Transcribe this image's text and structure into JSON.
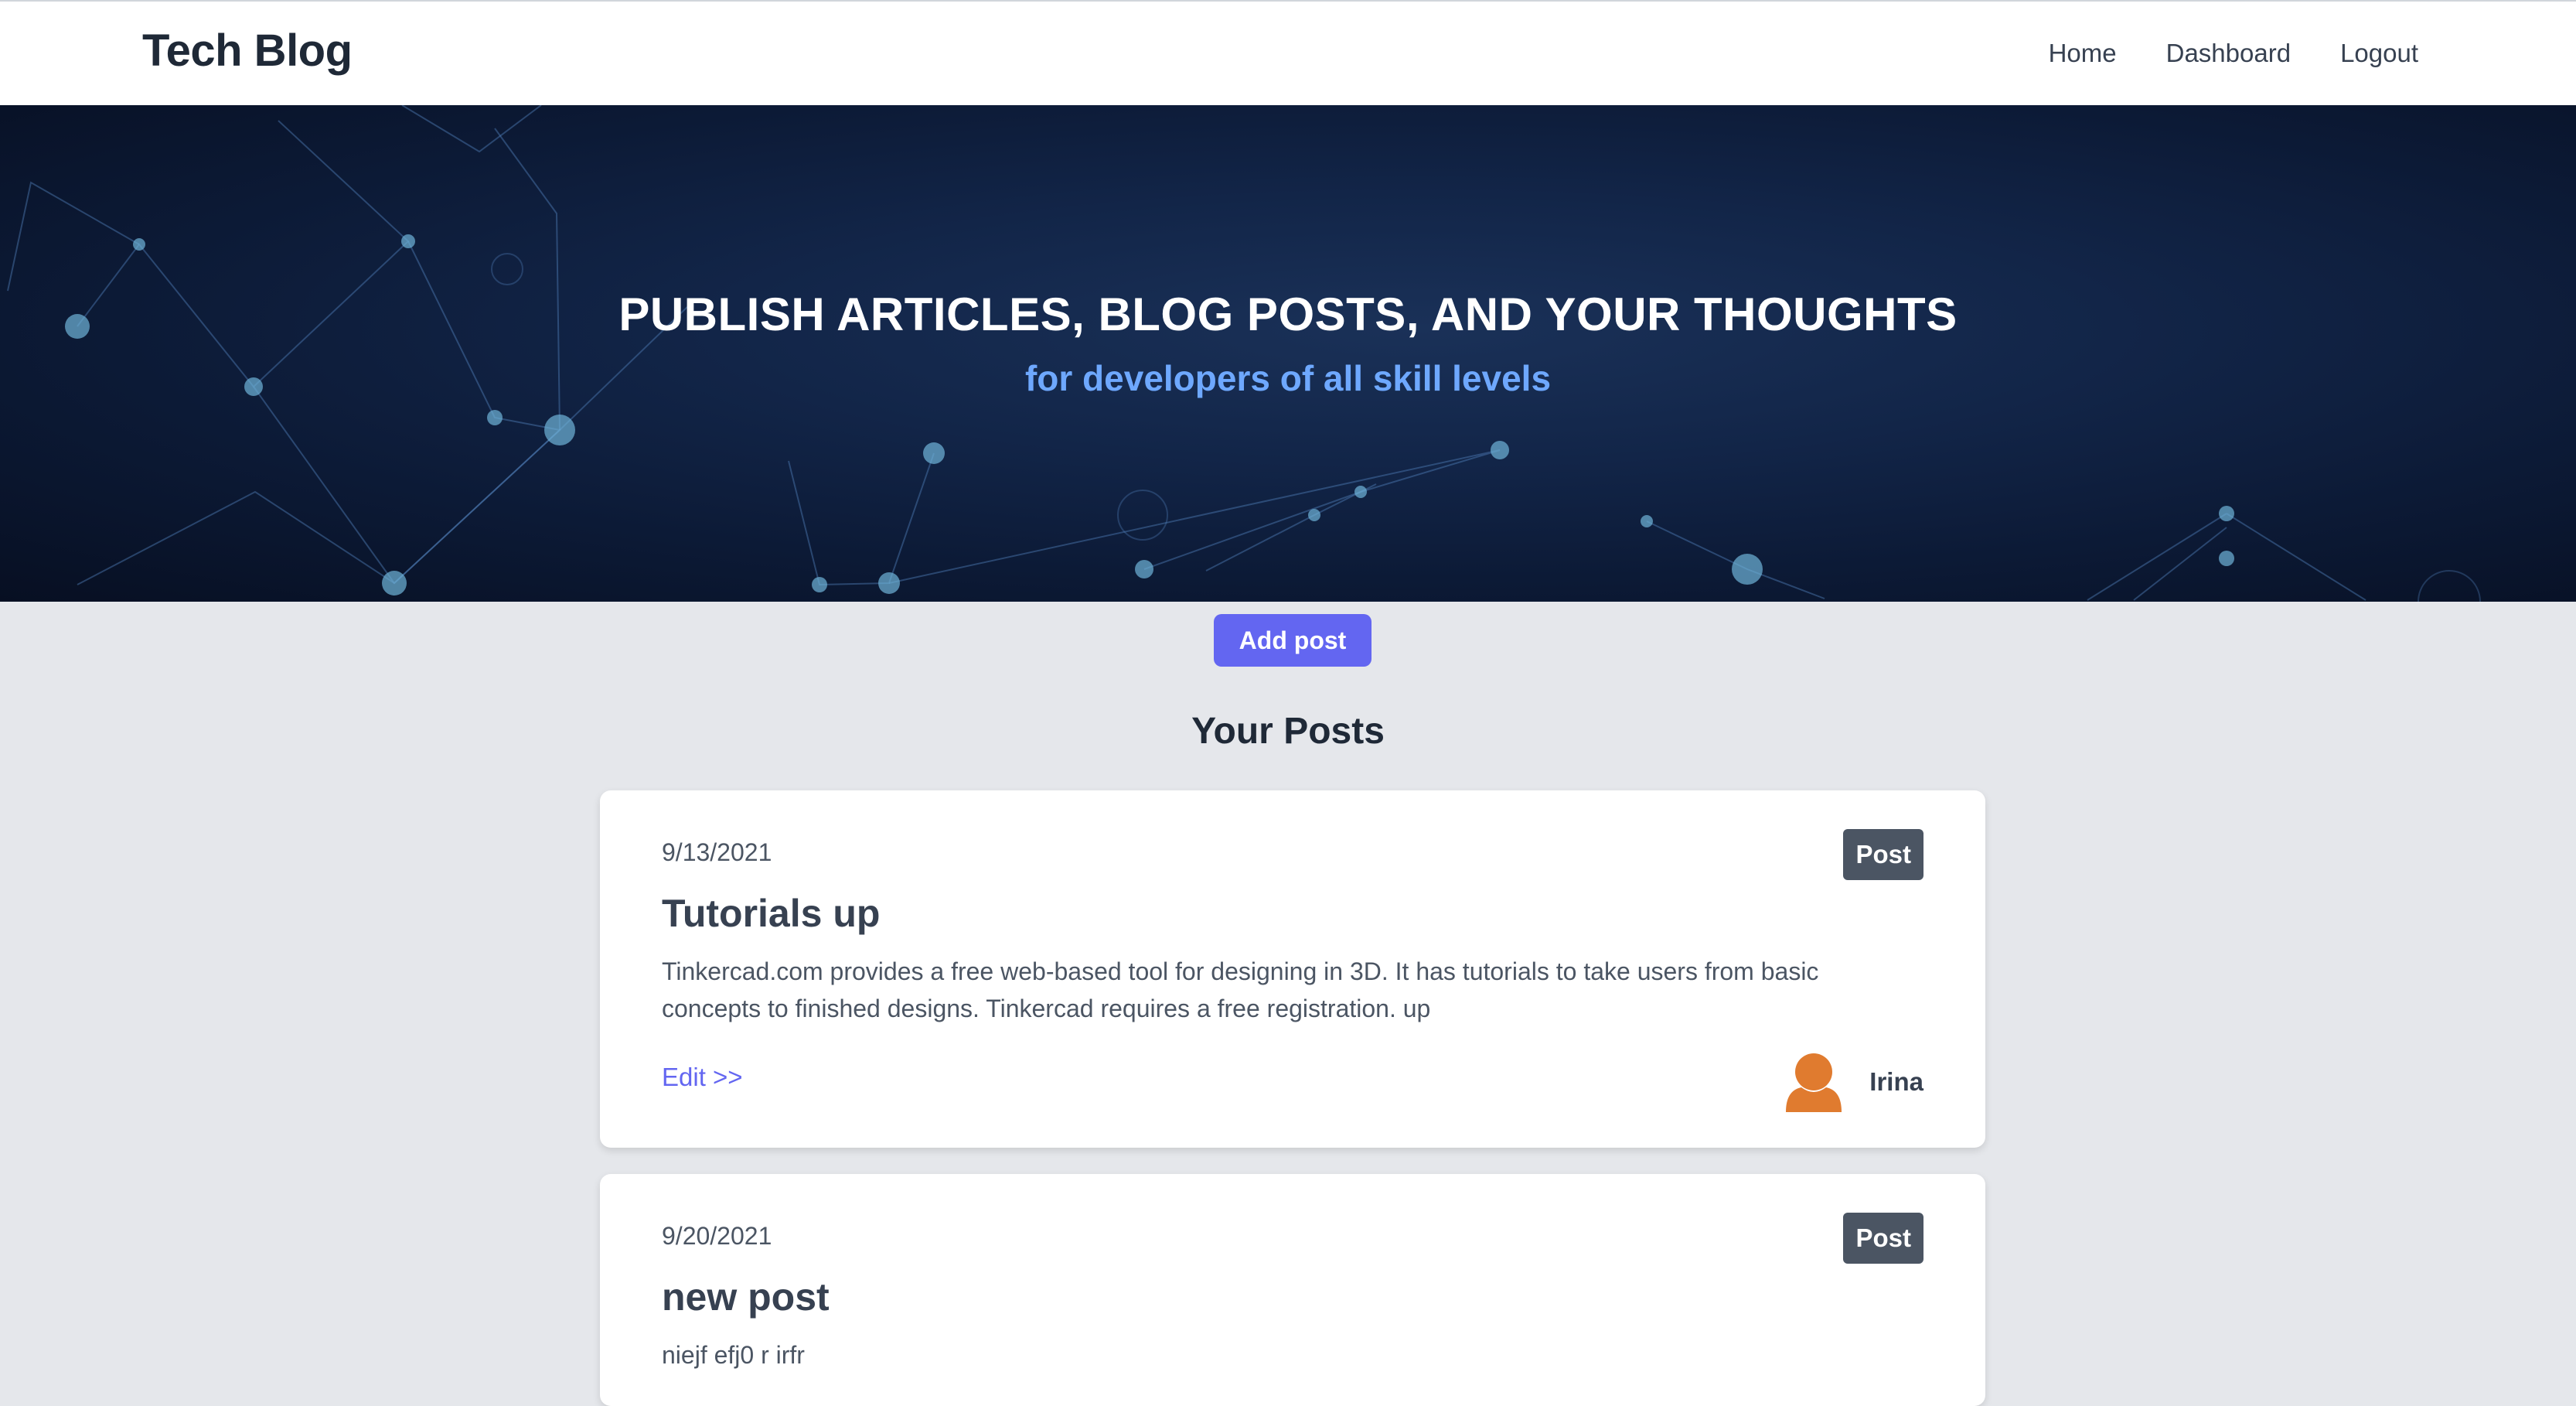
{
  "nav": {
    "brand": "Tech Blog",
    "links": [
      "Home",
      "Dashboard",
      "Logout"
    ]
  },
  "hero": {
    "title": "PUBLISH ARTICLES, BLOG POSTS, AND YOUR THOUGHTS",
    "subtitle": "for developers of all skill levels"
  },
  "actions": {
    "add_post": "Add post"
  },
  "section_title": "Your Posts",
  "posts": [
    {
      "date": "9/13/2021",
      "badge": "Post",
      "title": "Tutorials up",
      "body": "Tinkercad.com provides a free web-based tool for designing in 3D. It has tutorials to take users from basic concepts to finished designs. Tinkercad requires a free registration. up",
      "edit_label": "Edit >>",
      "author": "Irina"
    },
    {
      "date": "9/20/2021",
      "badge": "Post",
      "title": "new post",
      "body": "niejf efj0 r irfr"
    }
  ],
  "colors": {
    "accent": "#6366f1",
    "hero_subtitle": "#6ea8fe",
    "badge": "#4b5563",
    "avatar": "#e07b2f",
    "page_bg": "#e5e7eb"
  },
  "icons": {
    "avatar": "user-avatar-icon"
  }
}
